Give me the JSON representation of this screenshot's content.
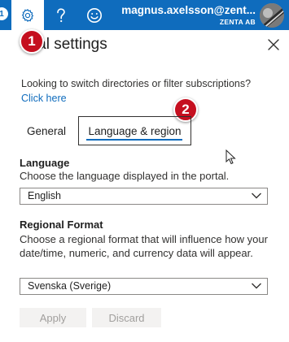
{
  "topbar": {
    "left_notification": "1",
    "account_email": "magnus.axelsson@zent...",
    "account_org": "ZENTA AB"
  },
  "panel": {
    "title": "ortal settings",
    "intro_text": "Looking to switch directories or filter subscriptions?",
    "link_text": "Click here",
    "tabs": [
      {
        "label": "General"
      },
      {
        "label": "Language & region",
        "selected": true
      }
    ],
    "language": {
      "title": "Language",
      "description": "Choose the language displayed in the portal.",
      "selected_value": "English"
    },
    "regional_format": {
      "title": "Regional Format",
      "description": "Choose a regional format that will influence how your date/time, numeric, and currency data will appear.",
      "selected_value": "Svenska (Sverige)"
    },
    "buttons": {
      "apply": "Apply",
      "discard": "Discard"
    }
  },
  "annotations": {
    "badge_1": "1",
    "badge_2": "2"
  },
  "colors": {
    "accent": "#0f6cbd",
    "badge": "#c50f1f",
    "disabled_text": "#a19f9d",
    "disabled_bg": "#f3f2f1"
  },
  "icons": [
    "settings-gear-icon",
    "help-question-icon",
    "feedback-smiley-icon",
    "close-icon",
    "chevron-down-icon",
    "mouse-cursor-icon"
  ]
}
